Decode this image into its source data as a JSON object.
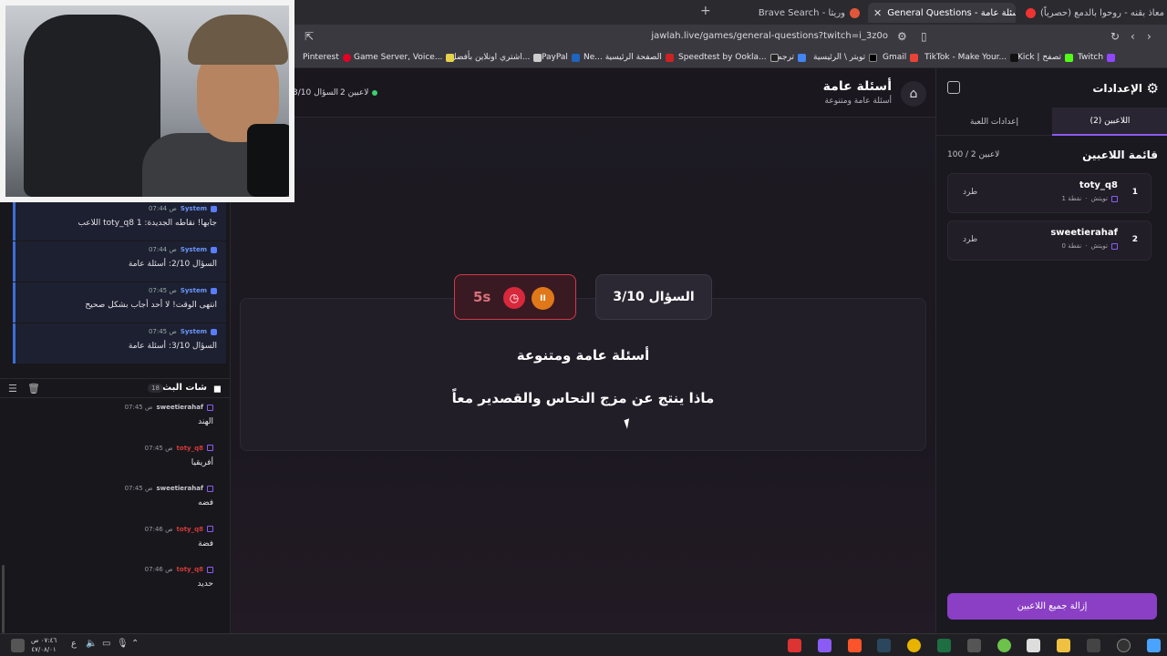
{
  "browser": {
    "tabs": [
      {
        "title": "معاذ بقنه - روحوا بالدمع (حصرياً) |",
        "active": false
      },
      {
        "title": "General Questions - أسئلة عامة",
        "active": true
      },
      {
        "title": "Brave Search - وريتا",
        "active": false
      }
    ],
    "url": "jawlah.live/games/general-questions?twitch=i_3z0o",
    "bookmarks": [
      "Twitch",
      "Kick | تصفح",
      "TikTok - Make Your...",
      "Gmail",
      "تويتر \\ الرئيسية",
      "ترجمة",
      "Speedtest by Ookla...",
      "Ne... الصفحة الرئيسية",
      "PayPal",
      "اشتري اونلاين بأفضل...",
      "Game Server, Voice...",
      "Pinterest"
    ]
  },
  "system_messages": [
    {
      "name": "System",
      "time": "07:44 ص",
      "text": "اللاعب toty_q8 جابها! نقاطه الجديدة: 1"
    },
    {
      "name": "System",
      "time": "07:44 ص",
      "text": "السؤال 2/10: أسئلة عامة"
    },
    {
      "name": "System",
      "time": "07:45 ص",
      "text": "انتهى الوقت! لا أحد أجاب بشكل صحيح"
    },
    {
      "name": "System",
      "time": "07:45 ص",
      "text": "السؤال 3/10: أسئلة عامة"
    }
  ],
  "chat": {
    "title": "شات البث",
    "count": "18",
    "messages": [
      {
        "name": "sweetierahaf",
        "time": "07:45 ص",
        "text": "الهند",
        "red": false
      },
      {
        "name": "toty_q8",
        "time": "07:45 ص",
        "text": "أفريقيا",
        "red": true
      },
      {
        "name": "sweetierahaf",
        "time": "07:45 ص",
        "text": "فضه",
        "red": false
      },
      {
        "name": "toty_q8",
        "time": "07:46 ص",
        "text": "فضة",
        "red": true
      },
      {
        "name": "toty_q8",
        "time": "07:46 ص",
        "text": "حديد",
        "red": true
      }
    ]
  },
  "game": {
    "title": "أسئلة عامة",
    "subtitle": "أسئلة عامة ومتنوعة",
    "players_pill": "2 لاعبين",
    "question_pill": "السؤال 3/10",
    "question_number": "السؤال 3/10",
    "timer": "5s",
    "pause_label": "II",
    "category": "أسئلة عامة ومتنوعة",
    "question": "ماذا ينتج عن مزج النحاس والقصدير معاً"
  },
  "settings": {
    "title": "الإعدادات",
    "tabs": [
      "اللاعبين (2)",
      "إعدادات اللعبة"
    ],
    "list_title": "قائمة اللاعبين",
    "list_count": "100 / 2 لاعبين",
    "kick_label": "طرد",
    "players": [
      {
        "rank": "1",
        "name": "toty_q8",
        "platform": "تويتش",
        "points": "1 نقطة"
      },
      {
        "rank": "2",
        "name": "sweetierahaf",
        "platform": "تويتش",
        "points": "0 نقطة"
      }
    ],
    "remove_all": "إزالة جميع اللاعبين"
  },
  "taskbar": {
    "time": "٠٧:٤٦ ص",
    "date": "٤٧/٠٨/٠١",
    "lang": "ع"
  },
  "colors": {
    "accent": "#8a3fc4",
    "timer_red": "#d8283c",
    "pause_orange": "#e0781a",
    "online_green": "#39d16c",
    "system_blue": "#3b6fd6"
  }
}
